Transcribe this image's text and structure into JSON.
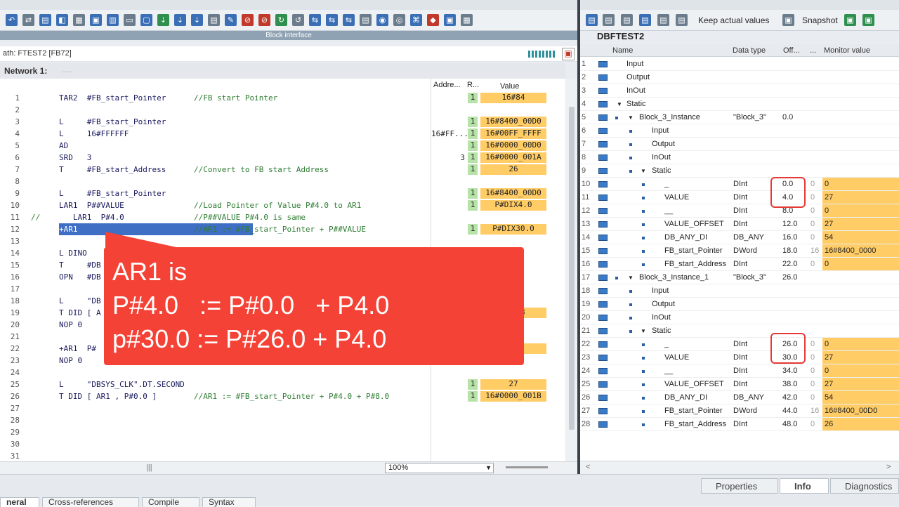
{
  "block_interface_label": "Block interface",
  "path_text": "ath: FTEST2 [FB72]",
  "network_title": "Network 1:",
  "network_dots": ".....",
  "columns": {
    "address": "Addre...",
    "r": "R...",
    "value": "Value"
  },
  "code_rows": [
    {
      "n": "1",
      "code": "TAR2  #FB_start_Pointer",
      "cmt": "//FB start Pointer",
      "addr": "",
      "r": "1",
      "val": "16#84"
    },
    {
      "n": "2",
      "code": "",
      "cmt": "",
      "addr": "",
      "r": "",
      "val": ""
    },
    {
      "n": "3",
      "code": "L     #FB_start_Pointer",
      "cmt": "",
      "addr": "",
      "r": "1",
      "val": "16#8400_00D0"
    },
    {
      "n": "4",
      "code": "L     16#FFFFFF",
      "cmt": "",
      "addr": "16#FF...",
      "r": "1",
      "val": "16#00FF_FFFF"
    },
    {
      "n": "5",
      "code": "AD",
      "cmt": "",
      "addr": "",
      "r": "1",
      "val": "16#0000_00D0"
    },
    {
      "n": "6",
      "code": "SRD   3",
      "cmt": "",
      "addr": "3",
      "r": "1",
      "val": "16#0000_001A"
    },
    {
      "n": "7",
      "code": "T     #FB_start_Address",
      "cmt": "//Convert to FB start Address",
      "addr": "",
      "r": "1",
      "val": "26"
    },
    {
      "n": "8",
      "code": "",
      "cmt": "",
      "addr": "",
      "r": "",
      "val": ""
    },
    {
      "n": "9",
      "code": "L     #FB_start_Pointer",
      "cmt": "",
      "addr": "",
      "r": "1",
      "val": "16#8400_00D0"
    },
    {
      "n": "10",
      "code": "LAR1  P##VALUE",
      "cmt": "//Load Pointer of Value P#4.0 to AR1",
      "addr": "",
      "r": "1",
      "val": "P#DIX4.0"
    },
    {
      "n": "11",
      "code": "   LAR1  P#4.0",
      "cmt": "//P##VALUE P#4.0 is same",
      "addr": "",
      "r": "",
      "val": ""
    },
    {
      "n": "12",
      "code": "+AR1",
      "cmt": "//AR1 := #FB_start_Pointer + P##VALUE",
      "addr": "",
      "r": "1",
      "val": "P#DIX30.0"
    },
    {
      "n": "13",
      "code": "",
      "cmt": "",
      "addr": "",
      "r": "",
      "val": ""
    },
    {
      "n": "14",
      "code": "L DINO",
      "cmt": "",
      "addr": "",
      "r": "",
      "val": ""
    },
    {
      "n": "15",
      "code": "T     #DB",
      "cmt": "",
      "addr": "",
      "r": "",
      "val": ""
    },
    {
      "n": "16",
      "code": "OPN   #DB",
      "cmt": "",
      "addr": "",
      "r": "",
      "val": ""
    },
    {
      "n": "17",
      "code": "",
      "cmt": "",
      "addr": "",
      "r": "",
      "val": ""
    },
    {
      "n": "18",
      "code": "L     \"DB",
      "cmt": "",
      "addr": "",
      "r": "",
      "val": ""
    },
    {
      "n": "19",
      "code": "T DID [ A",
      "cmt": "",
      "addr": "",
      "r": "",
      "val": "_001B"
    },
    {
      "n": "20",
      "code": "NOP 0",
      "cmt": "",
      "addr": "",
      "r": "",
      "val": ""
    },
    {
      "n": "21",
      "code": "",
      "cmt": "",
      "addr": "",
      "r": "",
      "val": ""
    },
    {
      "n": "22",
      "code": "+AR1  P#",
      "cmt": "",
      "addr": "",
      "r": "",
      "val": "8.0"
    },
    {
      "n": "23",
      "code": "NOP 0",
      "cmt": "",
      "addr": "",
      "r": "",
      "val": ""
    },
    {
      "n": "24",
      "code": "",
      "cmt": "",
      "addr": "",
      "r": "",
      "val": ""
    },
    {
      "n": "25",
      "code": "L     \"DBSYS_CLK\".DT.SECOND",
      "cmt": "",
      "addr": "",
      "r": "1",
      "val": "27"
    },
    {
      "n": "26",
      "code": "T DID [ AR1 , P#0.0 ]",
      "cmt": "//AR1 := #FB_start_Pointer + P#4.0 + P#8.0",
      "addr": "",
      "r": "1",
      "val": "16#0000_001B"
    },
    {
      "n": "27",
      "code": "",
      "cmt": "",
      "addr": "",
      "r": "",
      "val": ""
    },
    {
      "n": "28",
      "code": "",
      "cmt": "",
      "addr": "",
      "r": "",
      "val": ""
    },
    {
      "n": "29",
      "code": "",
      "cmt": "",
      "addr": "",
      "r": "",
      "val": ""
    },
    {
      "n": "30",
      "code": "",
      "cmt": "",
      "addr": "",
      "r": "",
      "val": ""
    },
    {
      "n": "31",
      "code": "",
      "cmt": "",
      "addr": "",
      "r": "",
      "val": ""
    }
  ],
  "line11_prefix": "//",
  "callout": [
    "AR1 is",
    "P#4.0   := P#0.0   + P4.0",
    "p#30.0 := P#26.0 + P4.0"
  ],
  "zoom": "100%",
  "right_toolbar": {
    "keep_actual": "Keep actual values",
    "snapshot": "Snapshot"
  },
  "db_title": "DBFTEST2",
  "db_columns": {
    "name": "Name",
    "type": "Data type",
    "offset": "Off...",
    "dots": "...",
    "monitor": "Monitor value"
  },
  "db_rows": [
    {
      "n": "1",
      "name": "Input",
      "type": "",
      "off": "",
      "s": "",
      "mon": "",
      "indent": 0,
      "exp": ""
    },
    {
      "n": "2",
      "name": "Output",
      "type": "",
      "off": "",
      "s": "",
      "mon": "",
      "indent": 0,
      "exp": ""
    },
    {
      "n": "3",
      "name": "InOut",
      "type": "",
      "off": "",
      "s": "",
      "mon": "",
      "indent": 0,
      "exp": ""
    },
    {
      "n": "4",
      "name": "Static",
      "type": "",
      "off": "",
      "s": "",
      "mon": "",
      "indent": 0,
      "exp": "▼"
    },
    {
      "n": "5",
      "name": "Block_3_Instance",
      "type": "\"Block_3\"",
      "off": "0.0",
      "s": "",
      "mon": "",
      "indent": 1,
      "exp": "▼"
    },
    {
      "n": "6",
      "name": "Input",
      "type": "",
      "off": "",
      "s": "",
      "mon": "",
      "indent": 2,
      "exp": ""
    },
    {
      "n": "7",
      "name": "Output",
      "type": "",
      "off": "",
      "s": "",
      "mon": "",
      "indent": 2,
      "exp": ""
    },
    {
      "n": "8",
      "name": "InOut",
      "type": "",
      "off": "",
      "s": "",
      "mon": "",
      "indent": 2,
      "exp": ""
    },
    {
      "n": "9",
      "name": "Static",
      "type": "",
      "off": "",
      "s": "",
      "mon": "",
      "indent": 2,
      "exp": "▼"
    },
    {
      "n": "10",
      "name": "_",
      "type": "DInt",
      "off": "0.0",
      "s": "0",
      "mon": "0",
      "indent": 3,
      "exp": ""
    },
    {
      "n": "11",
      "name": "VALUE",
      "type": "DInt",
      "off": "4.0",
      "s": "0",
      "mon": "27",
      "indent": 3,
      "exp": ""
    },
    {
      "n": "12",
      "name": "__",
      "type": "DInt",
      "off": "8.0",
      "s": "0",
      "mon": "0",
      "indent": 3,
      "exp": ""
    },
    {
      "n": "13",
      "name": "VALUE_OFFSET",
      "type": "DInt",
      "off": "12.0",
      "s": "0",
      "mon": "27",
      "indent": 3,
      "exp": ""
    },
    {
      "n": "14",
      "name": "DB_ANY_DI",
      "type": "DB_ANY",
      "off": "16.0",
      "s": "0",
      "mon": "54",
      "indent": 3,
      "exp": ""
    },
    {
      "n": "15",
      "name": "FB_start_Pointer",
      "type": "DWord",
      "off": "18.0",
      "s": "16",
      "mon": "16#8400_0000",
      "indent": 3,
      "exp": ""
    },
    {
      "n": "16",
      "name": "FB_start_Address",
      "type": "DInt",
      "off": "22.0",
      "s": "0",
      "mon": "0",
      "indent": 3,
      "exp": ""
    },
    {
      "n": "17",
      "name": "Block_3_Instance_1",
      "type": "\"Block_3\"",
      "off": "26.0",
      "s": "",
      "mon": "",
      "indent": 1,
      "exp": "▼"
    },
    {
      "n": "18",
      "name": "Input",
      "type": "",
      "off": "",
      "s": "",
      "mon": "",
      "indent": 2,
      "exp": ""
    },
    {
      "n": "19",
      "name": "Output",
      "type": "",
      "off": "",
      "s": "",
      "mon": "",
      "indent": 2,
      "exp": ""
    },
    {
      "n": "20",
      "name": "InOut",
      "type": "",
      "off": "",
      "s": "",
      "mon": "",
      "indent": 2,
      "exp": ""
    },
    {
      "n": "21",
      "name": "Static",
      "type": "",
      "off": "",
      "s": "",
      "mon": "",
      "indent": 2,
      "exp": "▼"
    },
    {
      "n": "22",
      "name": "_",
      "type": "DInt",
      "off": "26.0",
      "s": "0",
      "mon": "0",
      "indent": 3,
      "exp": ""
    },
    {
      "n": "23",
      "name": "VALUE",
      "type": "DInt",
      "off": "30.0",
      "s": "0",
      "mon": "27",
      "indent": 3,
      "exp": ""
    },
    {
      "n": "24",
      "name": "__",
      "type": "DInt",
      "off": "34.0",
      "s": "0",
      "mon": "0",
      "indent": 3,
      "exp": ""
    },
    {
      "n": "25",
      "name": "VALUE_OFFSET",
      "type": "DInt",
      "off": "38.0",
      "s": "0",
      "mon": "27",
      "indent": 3,
      "exp": ""
    },
    {
      "n": "26",
      "name": "DB_ANY_DI",
      "type": "DB_ANY",
      "off": "42.0",
      "s": "0",
      "mon": "54",
      "indent": 3,
      "exp": ""
    },
    {
      "n": "27",
      "name": "FB_start_Pointer",
      "type": "DWord",
      "off": "44.0",
      "s": "16",
      "mon": "16#8400_00D0",
      "indent": 3,
      "exp": ""
    },
    {
      "n": "28",
      "name": "FB_start_Address",
      "type": "DInt",
      "off": "48.0",
      "s": "0",
      "mon": "26",
      "indent": 3,
      "exp": ""
    }
  ],
  "bottom_tabs": {
    "properties": "Properties",
    "info": "Info",
    "diagnostics": "Diagnostics"
  },
  "bottom_subtabs": [
    "neral",
    "Cross-references",
    "Compile",
    "Syntax"
  ],
  "colors": {
    "monitor": "#ffcc66",
    "rlo": "#b7e2a8",
    "callout": "#f44336",
    "highlight": "#3f6fc4"
  }
}
